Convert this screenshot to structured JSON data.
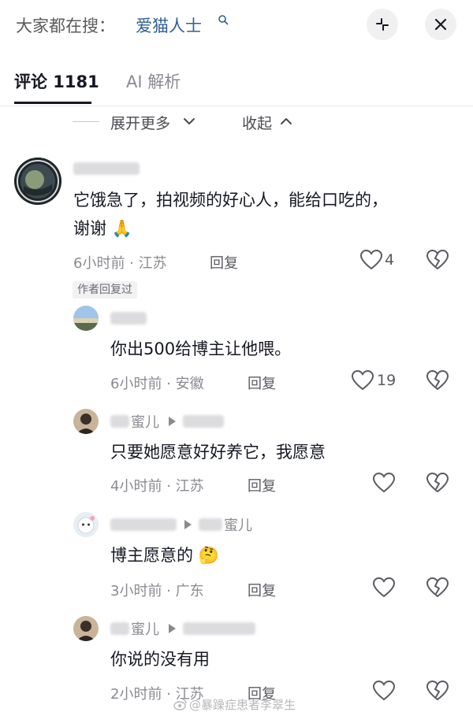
{
  "top_bar": {
    "search_prefix": "大家都在搜：",
    "search_term": "爱猫人士",
    "minimize_icon": "collapse-arrows-icon",
    "close_icon": "close-icon"
  },
  "tabs": [
    {
      "label": "评论 1181",
      "active": true
    },
    {
      "label": "AI 解析",
      "active": false
    }
  ],
  "thread_controls": {
    "expand_label": "展开更多",
    "collapse_label": "收起"
  },
  "comments": [
    {
      "id": "c1",
      "text_lines": [
        "它饿急了，拍视频的好心人，能给口吃的，",
        "谢谢 🙏"
      ],
      "time_location": "6小时前 · 江苏",
      "reply_label": "回复",
      "like_count": "4",
      "badge": "作者回复过"
    },
    {
      "id": "r1",
      "text": "你出500给博主让他喂。",
      "time_location": "6小时前 · 安徽",
      "reply_label": "回复",
      "like_count": "19"
    },
    {
      "id": "r2",
      "name_suffix": "蜜儿",
      "text": "只要她愿意好好养它，我愿意",
      "time_location": "4小时前 · 江苏",
      "reply_label": "回复"
    },
    {
      "id": "r3",
      "reply_to_suffix": "蜜儿",
      "text": "博主愿意的 🤔",
      "time_location": "3小时前 · 广东",
      "reply_label": "回复"
    },
    {
      "id": "r4",
      "name_suffix": "蜜儿",
      "text": "你说的没有用",
      "time_location": "2小时前 · 江苏",
      "reply_label": "回复"
    }
  ],
  "watermark": "@暴躁症患者李翠生",
  "colors": {
    "link_blue": "#2e5f93",
    "meta_gray": "#8a8b91",
    "text_dark": "#161823"
  }
}
